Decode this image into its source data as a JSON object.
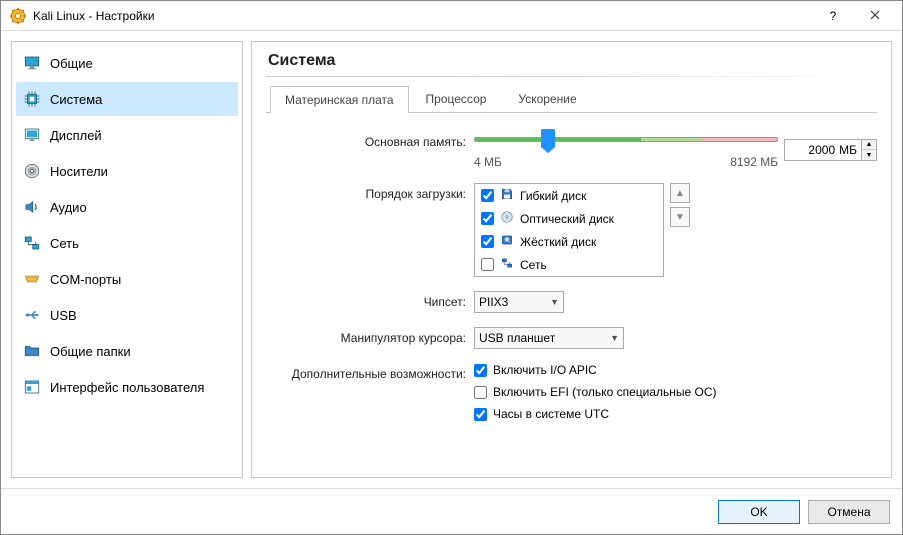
{
  "window": {
    "title": "Kali Linux - Настройки"
  },
  "sidebar": {
    "items": [
      {
        "label": "Общие",
        "icon": "monitor",
        "selected": false,
        "color": "#2fa4d6"
      },
      {
        "label": "Система",
        "icon": "chip",
        "selected": true,
        "color": "#2fa4d6"
      },
      {
        "label": "Дисплей",
        "icon": "display",
        "selected": false,
        "color": "#2fa4d6"
      },
      {
        "label": "Носители",
        "icon": "disc",
        "selected": false,
        "color": "#4f5d6d"
      },
      {
        "label": "Аудио",
        "icon": "speaker",
        "selected": false,
        "color": "#3d87c8"
      },
      {
        "label": "Сеть",
        "icon": "network",
        "selected": false,
        "color": "#2fa4d6"
      },
      {
        "label": "COM-порты",
        "icon": "serial",
        "selected": false,
        "color": "#f4a62a"
      },
      {
        "label": "USB",
        "icon": "usb",
        "selected": false,
        "color": "#3d87c8"
      },
      {
        "label": "Общие папки",
        "icon": "folder",
        "selected": false,
        "color": "#3d87c8"
      },
      {
        "label": "Интерфейс пользователя",
        "icon": "ui",
        "selected": false,
        "color": "#2fa4d6"
      }
    ]
  },
  "main": {
    "heading": "Система",
    "tabs": [
      {
        "label": "Материнская плата",
        "active": true
      },
      {
        "label": "Процессор",
        "active": false
      },
      {
        "label": "Ускорение",
        "active": false
      }
    ],
    "memory": {
      "label": "Основная память:",
      "min_label": "4 МБ",
      "max_label": "8192 МБ",
      "max": 8192,
      "value": 2000,
      "unit": "МБ"
    },
    "boot": {
      "label": "Порядок загрузки:",
      "items": [
        {
          "label": "Гибкий диск",
          "checked": true,
          "icon": "floppy"
        },
        {
          "label": "Оптический диск",
          "checked": true,
          "icon": "optical"
        },
        {
          "label": "Жёсткий диск",
          "checked": true,
          "icon": "hdd"
        },
        {
          "label": "Сеть",
          "checked": false,
          "icon": "net"
        }
      ]
    },
    "chipset": {
      "label": "Чипсет:",
      "value": "PIIX3"
    },
    "pointer": {
      "label": "Манипулятор курсора:",
      "value": "USB планшет"
    },
    "extras": {
      "label": "Дополнительные возможности:",
      "items": [
        {
          "label": "Включить I/O APIC",
          "checked": true
        },
        {
          "label": "Включить EFI (только специальные ОС)",
          "checked": false
        },
        {
          "label": "Часы в системе UTC",
          "checked": true
        }
      ]
    }
  },
  "footer": {
    "ok": "OK",
    "cancel": "Отмена"
  }
}
